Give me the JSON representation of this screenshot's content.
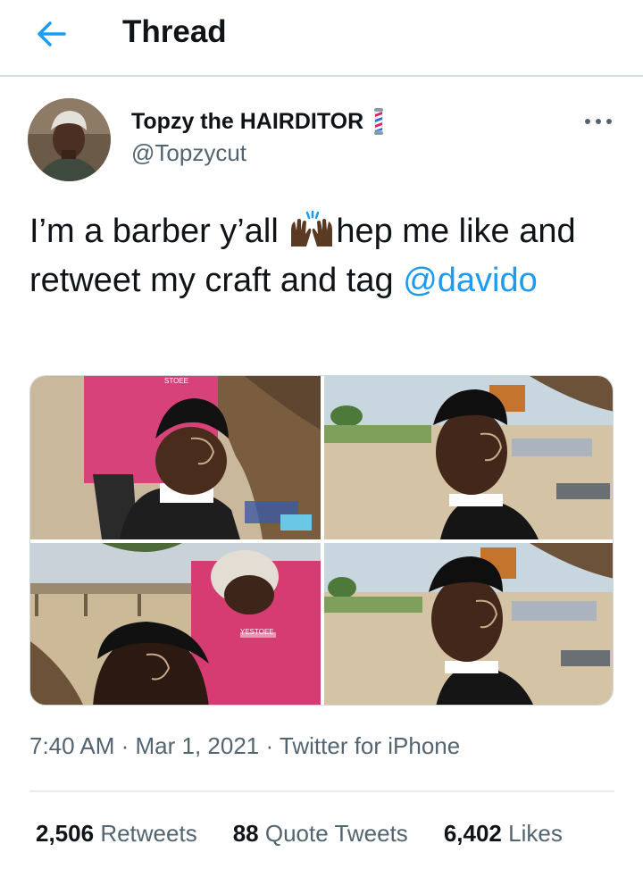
{
  "header": {
    "title": "Thread"
  },
  "tweet": {
    "display_name": "Topzy the HAIRDITOR",
    "handle": "@Topzycut",
    "text_part1": "I’m a barber y’all ",
    "text_part2": "hep me like and retweet my craft and tag ",
    "mention": "@davido",
    "emoji_icon": "raising-hands-icon",
    "badge_icon": "barber-pole-icon",
    "images": [
      {
        "overlay_text": "STOEE"
      },
      {
        "overlay_text": ""
      },
      {
        "overlay_text": "YESTOEE"
      },
      {
        "overlay_text": ""
      }
    ],
    "time": "7:40 AM",
    "date": "Mar 1, 2021",
    "source": "Twitter for iPhone",
    "separator": " · "
  },
  "stats": {
    "retweets_count": "2,506",
    "retweets_label": "Retweets",
    "quotes_count": "88",
    "quotes_label": "Quote Tweets",
    "likes_count": "6,402",
    "likes_label": "Likes"
  },
  "colors": {
    "accent": "#1d9bf0",
    "text": "#0f1419",
    "muted": "#536471"
  }
}
